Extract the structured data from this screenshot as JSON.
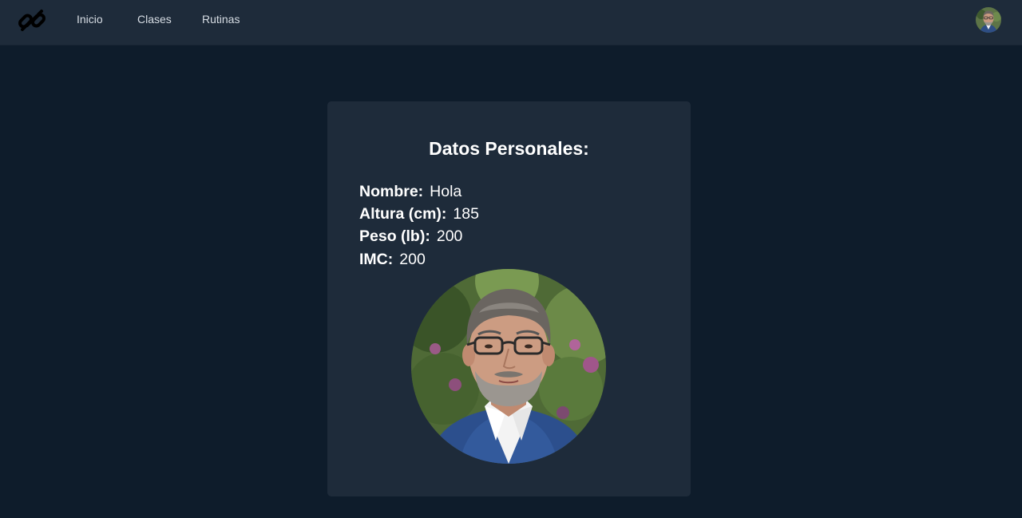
{
  "nav": {
    "logo_icon": "dumbbell-logo-icon",
    "links": [
      "Inicio",
      "Clases",
      "Rutinas"
    ],
    "avatar_icon": "user-avatar"
  },
  "profile": {
    "title": "Datos Personales:",
    "fields": [
      {
        "label": "Nombre:",
        "value": "Hola"
      },
      {
        "label": "Altura (cm):",
        "value": "185"
      },
      {
        "label": "Peso (lb):",
        "value": "200"
      },
      {
        "label": "IMC:",
        "value": "200"
      }
    ],
    "photo_icon": "profile-photo"
  },
  "colors": {
    "background": "#0e1c2b",
    "surface": "#1e2b3a",
    "text": "#ffffff"
  }
}
